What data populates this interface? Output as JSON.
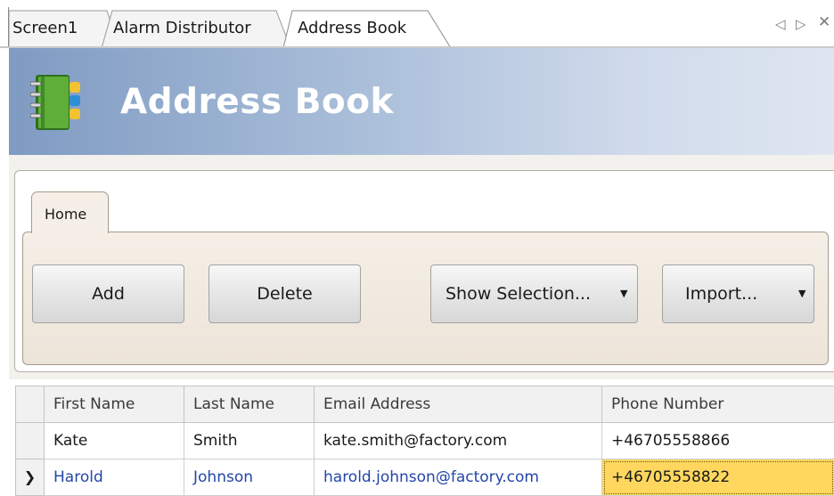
{
  "doc_tabs": [
    {
      "label": "Screen1",
      "active": false
    },
    {
      "label": "Alarm Distributor",
      "active": false
    },
    {
      "label": "Address Book",
      "active": true
    }
  ],
  "tab_nav": {
    "prev_icon": "triangle-left-icon",
    "next_icon": "triangle-right-icon",
    "close_icon": "close-icon"
  },
  "header": {
    "title": "Address Book",
    "icon": "address-book-icon"
  },
  "ribbon": {
    "tab_label": "Home",
    "buttons": {
      "add": "Add",
      "delete": "Delete",
      "show_selection": "Show Selection...",
      "import": "Import..."
    }
  },
  "grid": {
    "columns": [
      "First Name",
      "Last Name",
      "Email Address",
      "Phone Number"
    ],
    "rows": [
      {
        "first": "Kate",
        "last": "Smith",
        "email": "kate.smith@factory.com",
        "phone": "+46705558866",
        "selected": false
      },
      {
        "first": "Harold",
        "last": "Johnson",
        "email": "harold.johnson@factory.com",
        "phone": "+46705558822",
        "selected": true
      }
    ]
  },
  "colors": {
    "banner_start": "#7f9bc2",
    "banner_end": "#dfe6f1",
    "focused_cell": "#ffd75e",
    "selected_row_text": "#2346a8"
  }
}
